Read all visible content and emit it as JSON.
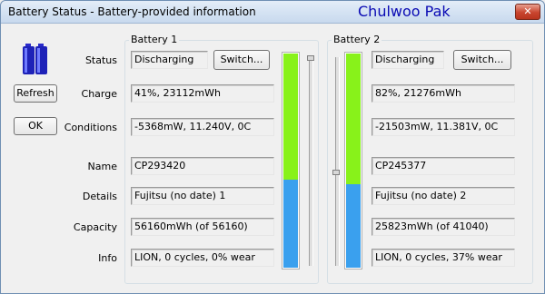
{
  "window": {
    "title": "Battery Status - Battery-provided information",
    "author": "Chulwoo Pak",
    "close_label": "✕"
  },
  "left": {
    "icon": "battery-icon",
    "refresh_label": "Refresh",
    "ok_label": "OK"
  },
  "labels": {
    "status": "Status",
    "charge": "Charge",
    "conditions": "Conditions",
    "name": "Name",
    "details": "Details",
    "capacity": "Capacity",
    "info": "Info"
  },
  "battery1": {
    "title": "Battery 1",
    "status": "Discharging",
    "switch_label": "Switch...",
    "charge": "41%, 23112mWh",
    "conditions": "-5368mW, 11.240V, 0C",
    "name": "CP293420",
    "details": "Fujitsu (no date) 1",
    "capacity": "56160mWh (of 56160)",
    "info": "LION, 0 cycles, 0% wear",
    "charge_fraction": 0.41,
    "colors": {
      "charge": "#3aa0ee",
      "empty": "#88f21a"
    }
  },
  "battery2": {
    "title": "Battery 2",
    "status": "Discharging",
    "switch_label": "Switch...",
    "charge": "82%, 21276mWh",
    "conditions": "-21503mW, 11.381V, 0C",
    "name": "CP245377",
    "details": "Fujitsu (no date) 2",
    "capacity": "25823mWh (of 41040)",
    "info": "LION, 0 cycles, 37% wear",
    "charge_fraction": 0.39,
    "colors": {
      "charge": "#3aa0ee",
      "empty": "#88f21a"
    }
  }
}
